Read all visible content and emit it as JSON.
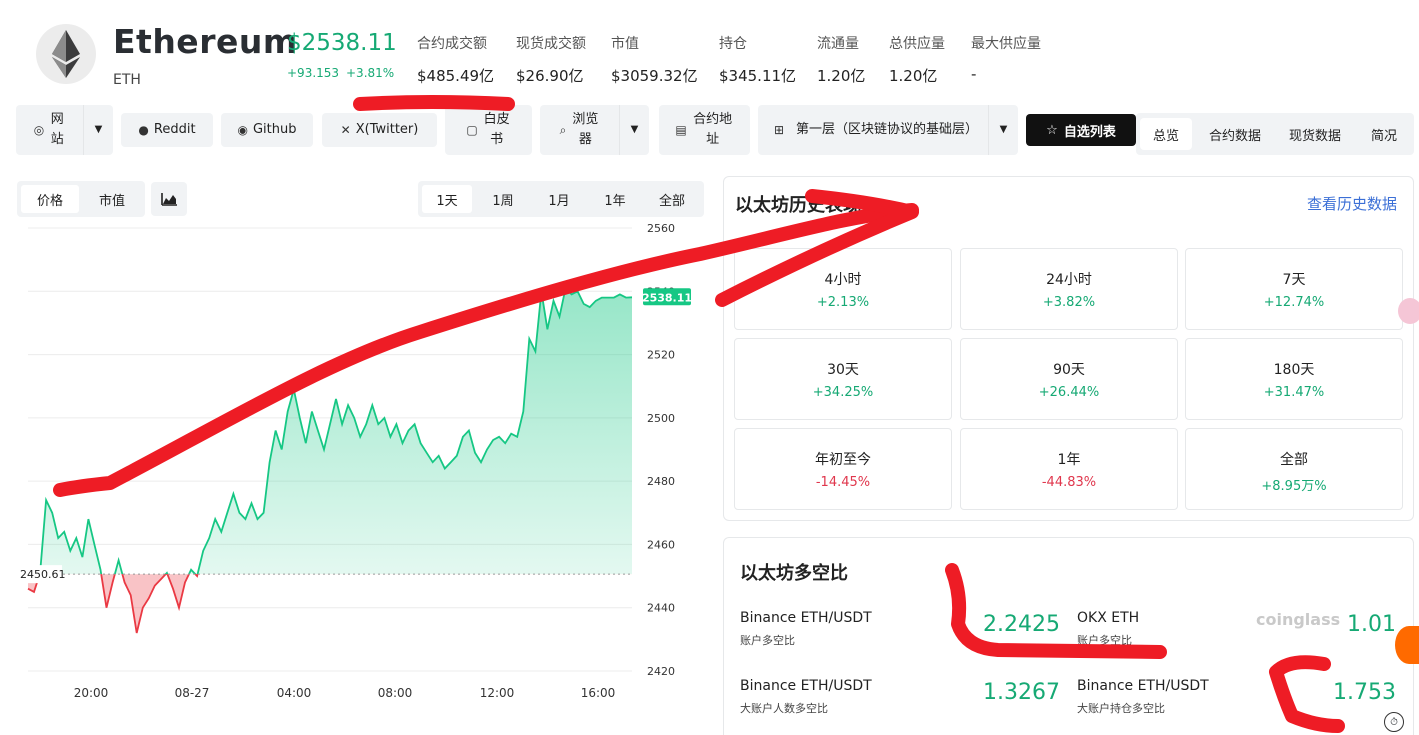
{
  "coin": {
    "name": "Ethereum",
    "symbol": "ETH",
    "price": "$2538.11",
    "change_abs": "+93.153",
    "change_pct": "+3.81%"
  },
  "stats": [
    {
      "label": "合约成交额",
      "value": "$485.49亿"
    },
    {
      "label": "现货成交额",
      "value": "$26.90亿"
    },
    {
      "label": "市值",
      "value": "$3059.32亿"
    },
    {
      "label": "持仓",
      "value": "$345.11亿"
    },
    {
      "label": "流通量",
      "value": "1.20亿"
    },
    {
      "label": "总供应量",
      "value": "1.20亿"
    },
    {
      "label": "最大供应量",
      "value": "-"
    }
  ],
  "links": {
    "website": "网站",
    "reddit": "Reddit",
    "github": "Github",
    "twitter": "X(Twitter)",
    "whitepaper": "白皮书",
    "explorer": "浏览器",
    "contract": "合约地址",
    "category": "第一层（区块链协议的基础层）",
    "watchlist": "自选列表"
  },
  "top_tabs": [
    "总览",
    "合约数据",
    "现货数据",
    "简况"
  ],
  "chart_controls": {
    "metric_tabs": [
      "价格",
      "市值"
    ],
    "range_tabs": [
      "1天",
      "1周",
      "1月",
      "1年",
      "全部"
    ]
  },
  "chart_data": {
    "type": "area",
    "title": "",
    "baseline": 2450.61,
    "baseline_label": "2450.61",
    "last_price_label": "2538.11",
    "ylim": [
      2420,
      2560
    ],
    "y_ticks": [
      2420,
      2440,
      2460,
      2480,
      2500,
      2520,
      2540,
      2560
    ],
    "x_ticks": [
      "20:00",
      "08-27",
      "04:00",
      "08:00",
      "12:00",
      "16:00"
    ],
    "colors": {
      "up": "#16c784",
      "down": "#ea3943"
    },
    "series": [
      {
        "x": [
          0,
          2,
          4,
          6,
          8,
          10,
          12,
          14,
          16,
          18,
          20,
          22,
          24,
          26,
          28,
          30,
          32,
          34,
          36,
          38,
          40,
          42,
          44,
          46,
          48,
          50,
          52,
          54,
          56,
          58,
          60,
          62,
          64,
          66,
          68,
          70,
          72,
          74,
          76,
          78,
          80,
          82,
          84,
          86,
          88,
          90,
          92,
          94,
          96,
          98,
          100,
          102,
          104,
          106,
          108,
          110,
          112,
          114,
          116,
          118,
          120,
          122,
          124,
          126,
          128,
          130,
          132,
          134,
          136,
          138,
          140,
          142,
          144,
          146,
          148,
          150,
          152,
          154,
          156,
          158,
          160,
          162,
          164,
          166,
          168,
          170,
          172,
          174,
          176,
          178,
          180,
          182,
          184,
          186,
          188,
          190,
          192,
          194,
          196,
          198,
          200
        ],
        "y": [
          2446,
          2445,
          2451,
          2474,
          2470,
          2462,
          2464,
          2458,
          2462,
          2456,
          2468,
          2460,
          2452,
          2440,
          2448,
          2455,
          2448,
          2444,
          2432,
          2440,
          2443,
          2447,
          2449,
          2451,
          2446,
          2440,
          2448,
          2452,
          2450,
          2458,
          2462,
          2468,
          2464,
          2470,
          2476,
          2470,
          2468,
          2473,
          2468,
          2470,
          2486,
          2496,
          2490,
          2502,
          2509,
          2500,
          2492,
          2502,
          2496,
          2490,
          2498,
          2506,
          2498,
          2504,
          2500,
          2494,
          2498,
          2504,
          2498,
          2500,
          2494,
          2498,
          2492,
          2496,
          2498,
          2492,
          2489,
          2486,
          2488,
          2484,
          2486,
          2488,
          2494,
          2496,
          2489,
          2486,
          2490,
          2493,
          2494,
          2492,
          2495,
          2494,
          2502,
          2525,
          2521,
          2540,
          2528,
          2537,
          2532,
          2541,
          2539,
          2540,
          2536,
          2535,
          2537,
          2538,
          2538,
          2538,
          2539,
          2538,
          2538.11
        ]
      }
    ]
  },
  "returns": {
    "title": "以太坊历史表现",
    "history_link": "查看历史数据",
    "cells": [
      {
        "period": "4小时",
        "value": "+2.13%",
        "dir": "pos"
      },
      {
        "period": "24小时",
        "value": "+3.82%",
        "dir": "pos"
      },
      {
        "period": "7天",
        "value": "+12.74%",
        "dir": "pos"
      },
      {
        "period": "30天",
        "value": "+34.25%",
        "dir": "pos"
      },
      {
        "period": "90天",
        "value": "+26.44%",
        "dir": "pos"
      },
      {
        "period": "180天",
        "value": "+31.47%",
        "dir": "pos"
      },
      {
        "period": "年初至今",
        "value": "-14.45%",
        "dir": "neg"
      },
      {
        "period": "1年",
        "value": "-44.83%",
        "dir": "neg"
      },
      {
        "period": "全部",
        "value": "+8.95万%",
        "dir": "pos"
      }
    ]
  },
  "long_short": {
    "title": "以太坊多空比",
    "watermark": "coinglass",
    "items": [
      {
        "name": "Binance ETH/USDT",
        "sub": "账户多空比",
        "value": "2.2425"
      },
      {
        "name": "OKX ETH",
        "sub": "账户多空比",
        "value": "1.01"
      },
      {
        "name": "Binance ETH/USDT",
        "sub": "大账户人数多空比",
        "value": "1.3267"
      },
      {
        "name": "Binance ETH/USDT",
        "sub": "大账户持仓多空比",
        "value": "1.753"
      }
    ]
  }
}
